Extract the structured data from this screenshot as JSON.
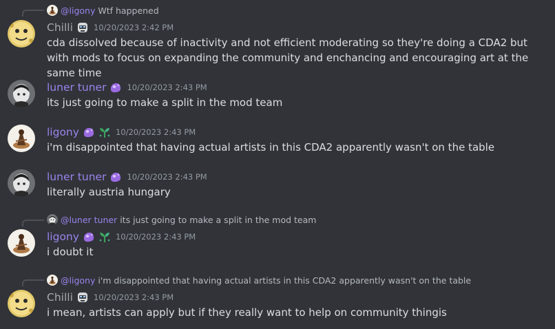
{
  "colors": {
    "background": "#313338",
    "username_purple": "#9b84ee",
    "username_gray": "#a5a9b0",
    "text": "#dbdee1",
    "timestamp": "#949ba4"
  },
  "messages": [
    {
      "reply": {
        "name": "@ligony",
        "text": "Wtf happened",
        "avatar_icon": "ligony-avatar-icon"
      },
      "author": "Chilli",
      "badges": [
        "robot-mask-badge-icon"
      ],
      "timestamp": "10/20/2023 2:42 PM",
      "text": "cda dissolved because of inactivity and not efficient moderating so they're doing a CDA2 but with mods to focus on expanding the community and enchancing and encouraging art at the same time"
    },
    {
      "author": "luner tuner",
      "badges": [
        "purple-blob-badge-icon"
      ],
      "timestamp": "10/20/2023 2:43 PM",
      "text": "its just going to make a split in the mod team"
    },
    {
      "author": "ligony",
      "badges": [
        "purple-blob-badge-icon",
        "green-sprout-badge-icon"
      ],
      "timestamp": "10/20/2023 2:43 PM",
      "text": "i'm disappointed that having actual artists in this CDA2 apparently wasn't on the table"
    },
    {
      "author": "luner tuner",
      "badges": [
        "purple-blob-badge-icon"
      ],
      "timestamp": "10/20/2023 2:43 PM",
      "text": "literally austria hungary"
    },
    {
      "reply": {
        "name": "@luner tuner",
        "text": "its just going to make a split in the mod team",
        "avatar_icon": "luner-tuner-avatar-icon"
      },
      "author": "ligony",
      "badges": [
        "purple-blob-badge-icon",
        "green-sprout-badge-icon"
      ],
      "timestamp": "10/20/2023 2:43 PM",
      "text": "i doubt it"
    },
    {
      "reply": {
        "name": "@ligony",
        "text": "i'm disappointed that having actual artists in this CDA2 apparently wasn't on the table",
        "avatar_icon": "ligony-avatar-icon"
      },
      "author": "Chilli",
      "badges": [
        "robot-mask-badge-icon"
      ],
      "timestamp": "10/20/2023 2:43 PM",
      "text": "i mean, artists can apply but if they really want to help on community thingis"
    }
  ]
}
